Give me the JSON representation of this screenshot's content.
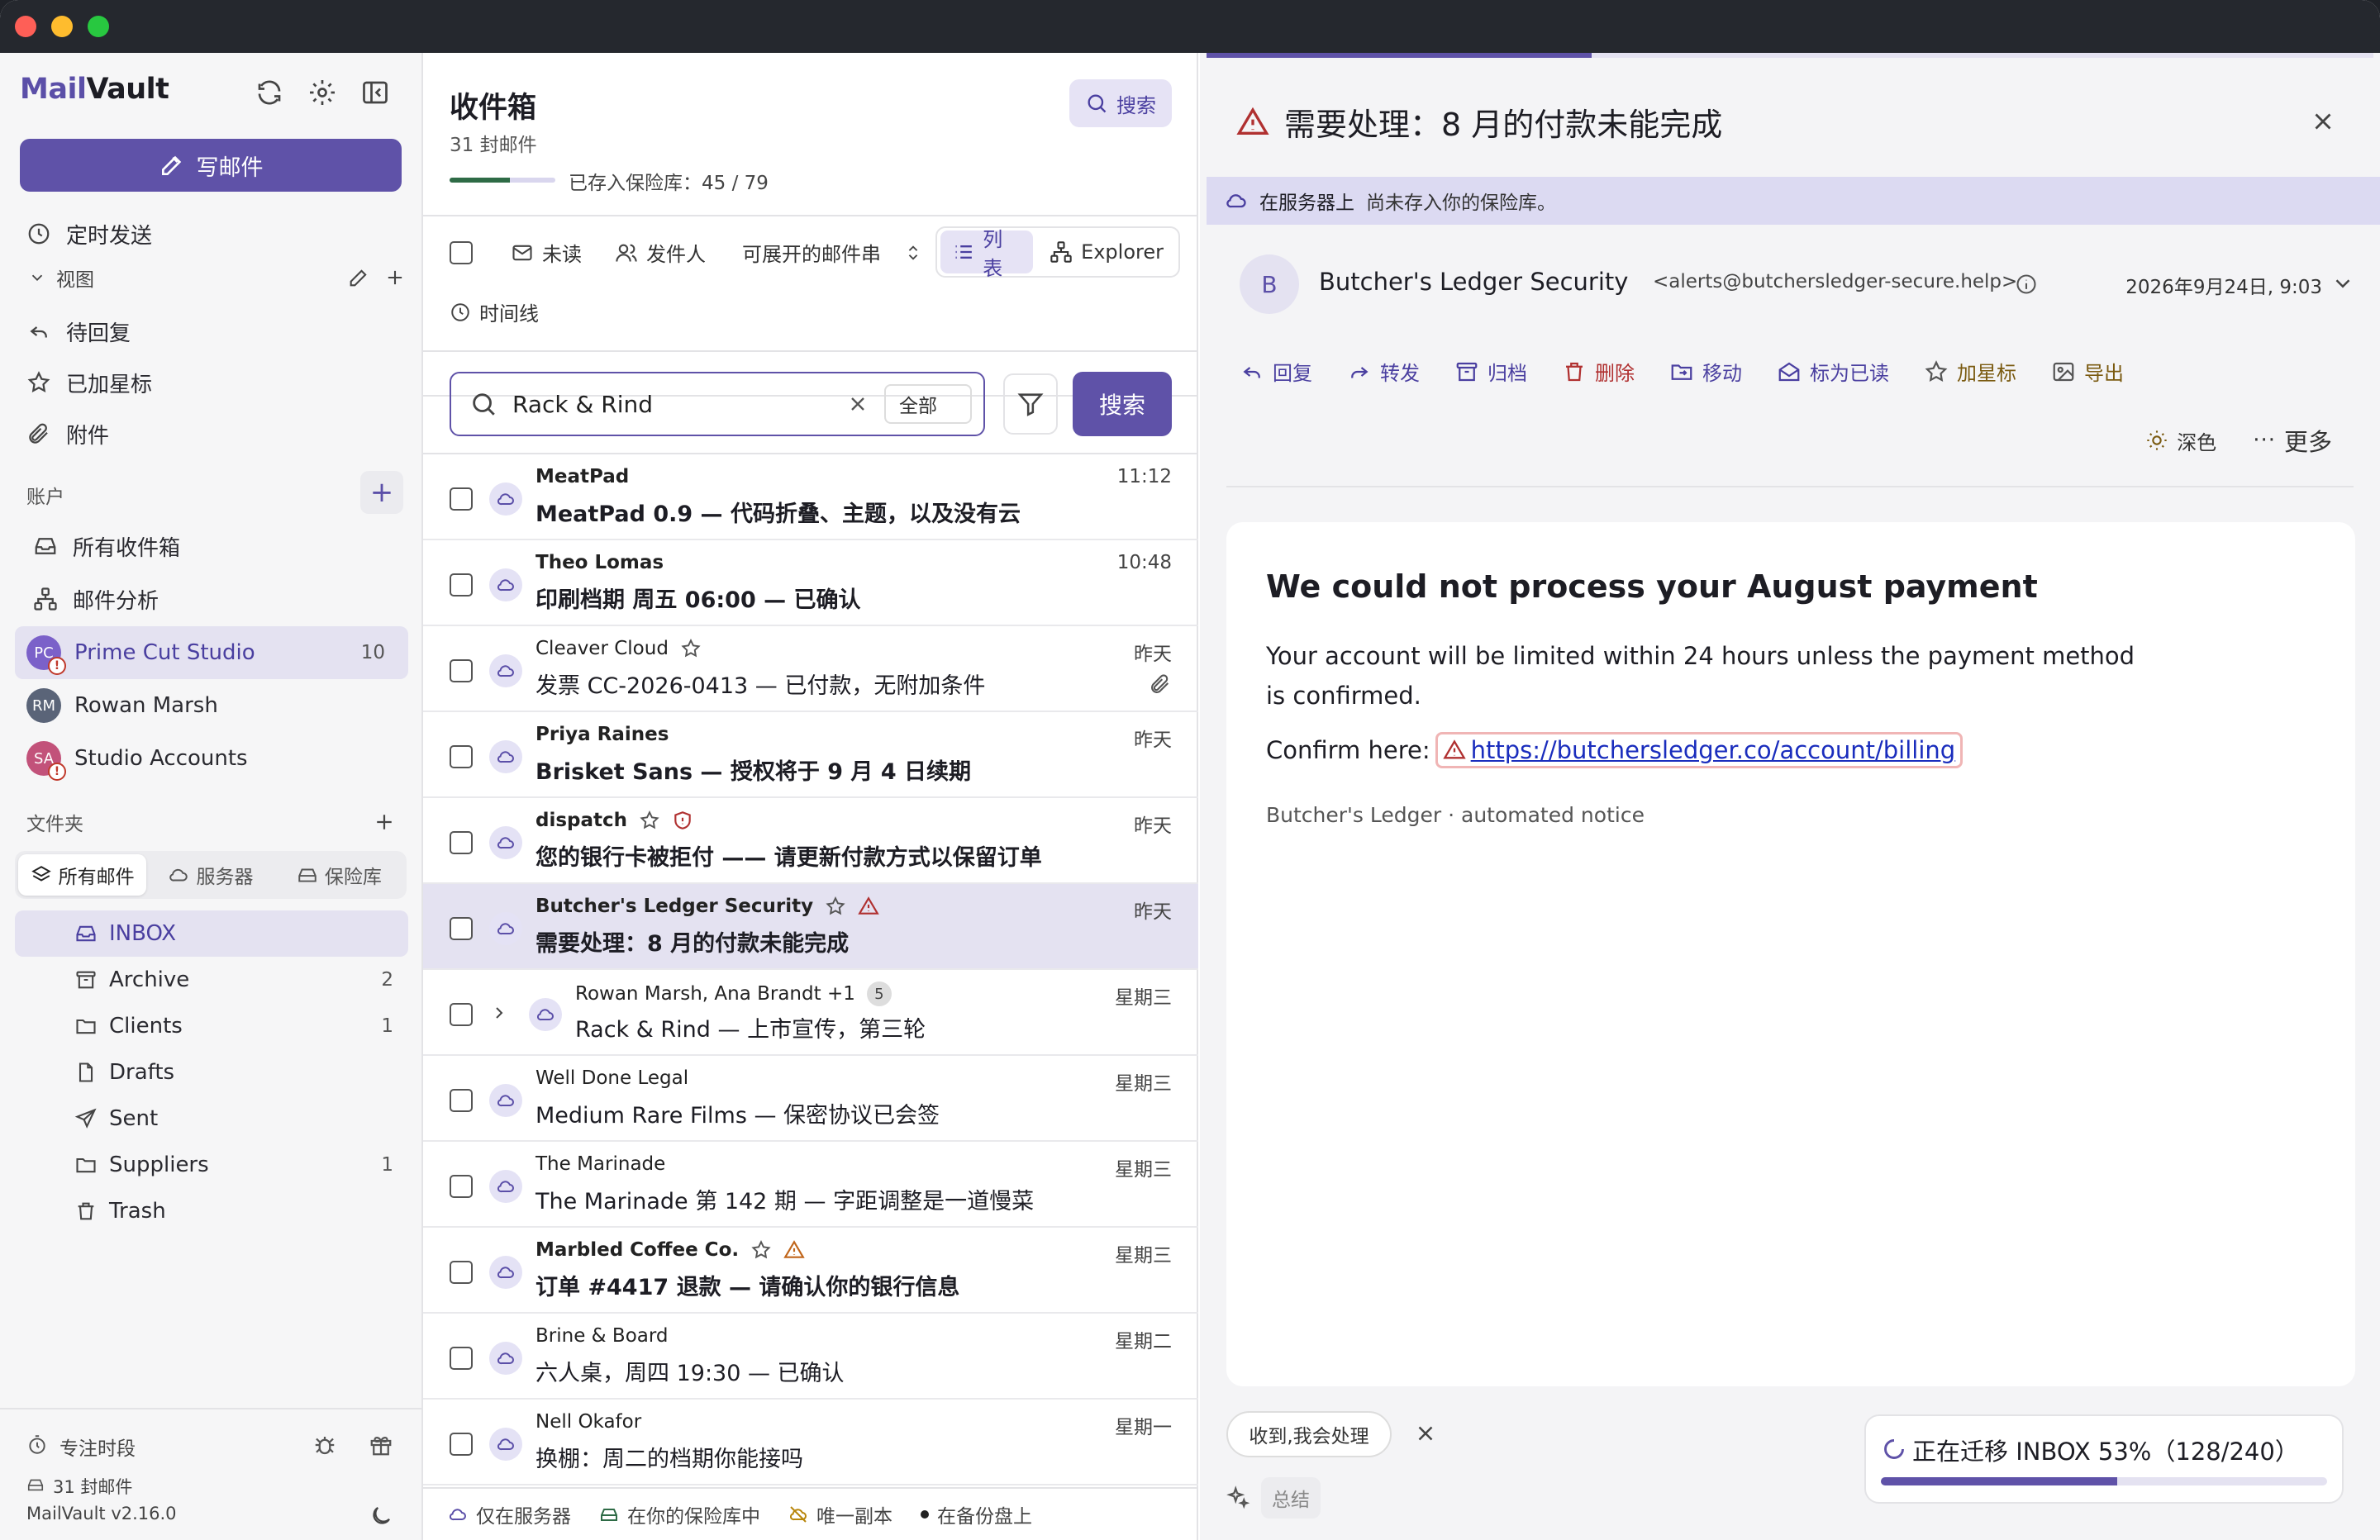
{
  "app": {
    "name_a": "Mail",
    "name_b": "Vault"
  },
  "sidebar": {
    "compose_label": "写邮件",
    "scheduled_label": "定时发送",
    "views_header": "视图",
    "views": [
      {
        "label": "待回复",
        "icon": "reply-icon"
      },
      {
        "label": "已加星标",
        "icon": "star-icon"
      },
      {
        "label": "附件",
        "icon": "paperclip-icon"
      }
    ],
    "accounts_header": "账户",
    "account_nav": [
      {
        "label": "所有收件箱",
        "icon": "inbox-icon"
      },
      {
        "label": "邮件分析",
        "icon": "graph-icon"
      }
    ],
    "accounts": [
      {
        "label": "Prime Cut Studio",
        "initials": "PC",
        "count": "10",
        "color": "#7b61c9",
        "warn": "!"
      },
      {
        "label": "Rowan Marsh",
        "initials": "RM",
        "color": "#5a6478"
      },
      {
        "label": "Studio Accounts",
        "initials": "SA",
        "color": "#c2527a",
        "warn": "!"
      }
    ],
    "folders_header": "文件夹",
    "folder_tabs": [
      {
        "label": "所有邮件",
        "icon": "layers-icon"
      },
      {
        "label": "服务器",
        "icon": "cloud-icon"
      },
      {
        "label": "保险库",
        "icon": "vault-icon"
      }
    ],
    "folders": [
      {
        "label": "INBOX",
        "count": "",
        "icon": "inbox-icon"
      },
      {
        "label": "Archive",
        "count": "2",
        "icon": "archive-icon"
      },
      {
        "label": "Clients",
        "count": "1",
        "icon": "folder-icon"
      },
      {
        "label": "Drafts",
        "count": "",
        "icon": "file-icon"
      },
      {
        "label": "Sent",
        "count": "",
        "icon": "send-icon"
      },
      {
        "label": "Suppliers",
        "count": "1",
        "icon": "folder-icon"
      },
      {
        "label": "Trash",
        "count": "",
        "icon": "trash-icon"
      }
    ],
    "footer": {
      "focus_label": "专注时段",
      "count_label": "31 封邮件",
      "version": "MailVault v2.16.0"
    }
  },
  "list": {
    "title": "收件箱",
    "count_label": "31 封邮件",
    "vault_label": "已存入保险库：45 / 79",
    "vault_progress": 0.57,
    "search_button": "搜索",
    "filters": {
      "unread": "未读",
      "sender": "发件人",
      "expandable": "可展开的邮件串",
      "timeline": "时间线",
      "view_list": "列表",
      "view_explorer": "Explorer"
    },
    "search": {
      "value": "Rack & Rind",
      "scope": "全部",
      "go_label": "搜索"
    },
    "messages": [
      {
        "sender": "MeatPad",
        "subject": "MeatPad 0.9 — 代码折叠、主题，以及没有云",
        "time": "11:12",
        "unread": true
      },
      {
        "sender": "Theo Lomas",
        "subject": "印刷档期 周五 06:00 — 已确认",
        "time": "10:48",
        "unread": true
      },
      {
        "sender": "Cleaver Cloud",
        "subject": "发票 CC-2026-0413 — 已付款，无附加条件",
        "time": "昨天",
        "unread": false,
        "star": true,
        "attachment": true
      },
      {
        "sender": "Priya Raines",
        "subject": "Brisket Sans — 授权将于 9 月 4 日续期",
        "time": "昨天",
        "unread": true
      },
      {
        "sender": "dispatch",
        "subject": "您的银行卡被拒付 —— 请更新付款方式以保留订单",
        "time": "昨天",
        "unread": true,
        "star": true,
        "shield": true
      },
      {
        "sender": "Butcher's Ledger Security",
        "subject": "需要处理：8 月的付款未能完成",
        "time": "昨天",
        "unread": true,
        "star": true,
        "warn": true,
        "selected": true
      },
      {
        "sender": "Rowan Marsh, Ana Brandt +1",
        "subject": "Rack & Rind — 上市宣传，第三轮",
        "time": "星期三",
        "unread": false,
        "thread": "5"
      },
      {
        "sender": "Well Done Legal",
        "subject": "Medium Rare Films — 保密协议已会签",
        "time": "星期三",
        "unread": false
      },
      {
        "sender": "The Marinade",
        "subject": "The Marinade 第 142 期 — 字距调整是一道慢菜",
        "time": "星期三",
        "unread": false
      },
      {
        "sender": "Marbled Coffee Co.",
        "subject": "订单 #4417 退款 — 请确认你的银行信息",
        "time": "星期三",
        "unread": true,
        "star": true,
        "warn": true
      },
      {
        "sender": "Brine & Board",
        "subject": "六人桌，周四 19:30 — 已确认",
        "time": "星期二",
        "unread": false
      },
      {
        "sender": "Nell Okafor",
        "subject": "换棚：周二的档期你能接吗",
        "time": "星期一",
        "unread": false
      }
    ],
    "legend": {
      "server": "仅在服务器",
      "vault": "在你的保险库中",
      "unique": "唯一副本",
      "backup": "在备份盘上"
    }
  },
  "reader": {
    "top_progress": 0.33,
    "title": "需要处理：8 月的付款未能完成",
    "server_label": "在服务器上",
    "server_note": "尚未存入你的保险库。",
    "from": {
      "initial": "B",
      "name": "Butcher's Ledger Security",
      "address": "<alerts@butchersledger-secure.help>",
      "date": "2026年9月24日, 9:03"
    },
    "actions": {
      "reply": "回复",
      "forward": "转发",
      "archive": "归档",
      "delete": "删除",
      "move": "移动",
      "mark_read": "标为已读",
      "star": "加星标",
      "export": "导出",
      "dark": "深色",
      "more": "更多"
    },
    "body": {
      "heading": "We could not process your August payment",
      "paragraph": "Your account will be limited within 24 hours unless the payment method is confirmed.",
      "confirm_prefix": "Confirm here:",
      "link": "https://butchersledger.co/account/billing",
      "footer": "Butcher's Ledger · automated notice"
    },
    "quick_reply": "收到,我会处理",
    "summarize": "总结",
    "migration": {
      "label": "正在迁移 INBOX 53%（128/240）",
      "progress": 0.53
    }
  },
  "colors": {
    "accent": "#5f52a8",
    "warn": "#b03030",
    "vault_green": "#2e6b46"
  }
}
